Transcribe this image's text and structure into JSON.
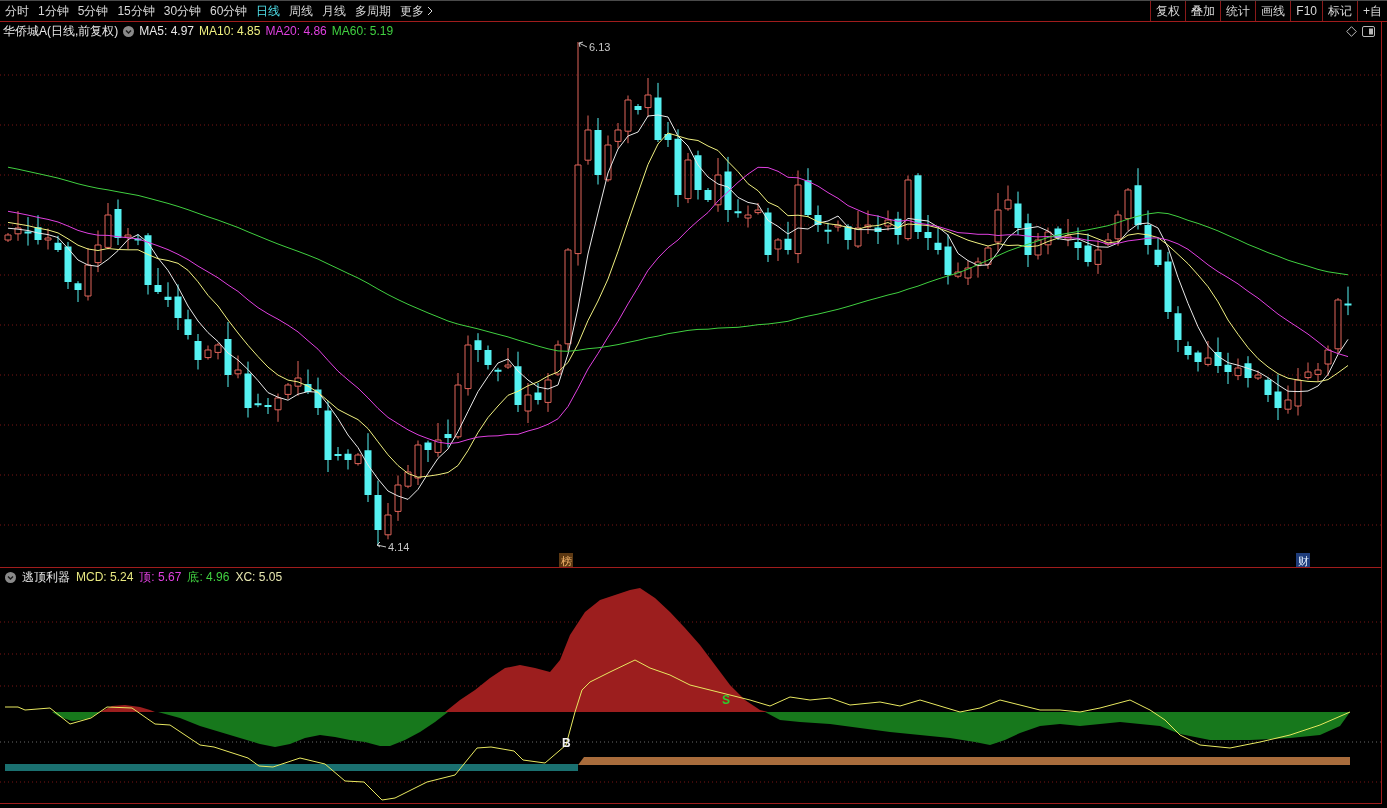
{
  "toolbar": {
    "periods": [
      {
        "label": "分时",
        "selected": false,
        "kind": "period"
      },
      {
        "label": "1分钟",
        "selected": false,
        "kind": "period"
      },
      {
        "label": "5分钟",
        "selected": false,
        "kind": "period"
      },
      {
        "label": "15分钟",
        "selected": false,
        "kind": "period"
      },
      {
        "label": "30分钟",
        "selected": false,
        "kind": "period"
      },
      {
        "label": "60分钟",
        "selected": false,
        "kind": "period"
      },
      {
        "label": "日线",
        "selected": true,
        "kind": "period"
      },
      {
        "label": "周线",
        "selected": false,
        "kind": "period"
      },
      {
        "label": "月线",
        "selected": false,
        "kind": "period"
      },
      {
        "label": "多周期",
        "selected": false,
        "kind": "period"
      },
      {
        "label": "更多",
        "selected": false,
        "kind": "menu"
      }
    ],
    "tools": [
      {
        "label": "复权"
      },
      {
        "label": "叠加"
      },
      {
        "label": "统计"
      },
      {
        "label": "画线"
      },
      {
        "label": "F10"
      },
      {
        "label": "标记"
      },
      {
        "label": "+自"
      }
    ]
  },
  "chart": {
    "title": "华侨城A(日线,前复权)",
    "moving_averages": [
      {
        "label": "MA5: 4.97",
        "color": "#e8e8e8"
      },
      {
        "label": "MA10: 4.85",
        "color": "#f0f080"
      },
      {
        "label": "MA20: 4.86",
        "color": "#e040e0"
      },
      {
        "label": "MA60: 5.19",
        "color": "#40d040"
      }
    ],
    "high_label": "6.13",
    "low_label": "4.14",
    "markers": [
      {
        "label": "榜",
        "kind": "list"
      },
      {
        "label": "财",
        "kind": "report"
      }
    ]
  },
  "indicator": {
    "title": "逃顶利器",
    "values": [
      {
        "label": "MCD: 5.24",
        "color": "#e8e880"
      },
      {
        "label": "顶: 5.67",
        "color": "#e040e0"
      },
      {
        "label": "底: 4.96",
        "color": "#40d040"
      },
      {
        "label": "XC: 5.05",
        "color": "#e8e8b0"
      }
    ],
    "signals": [
      {
        "label": "S",
        "kind": "sell"
      },
      {
        "label": "B",
        "kind": "buy"
      }
    ]
  }
}
